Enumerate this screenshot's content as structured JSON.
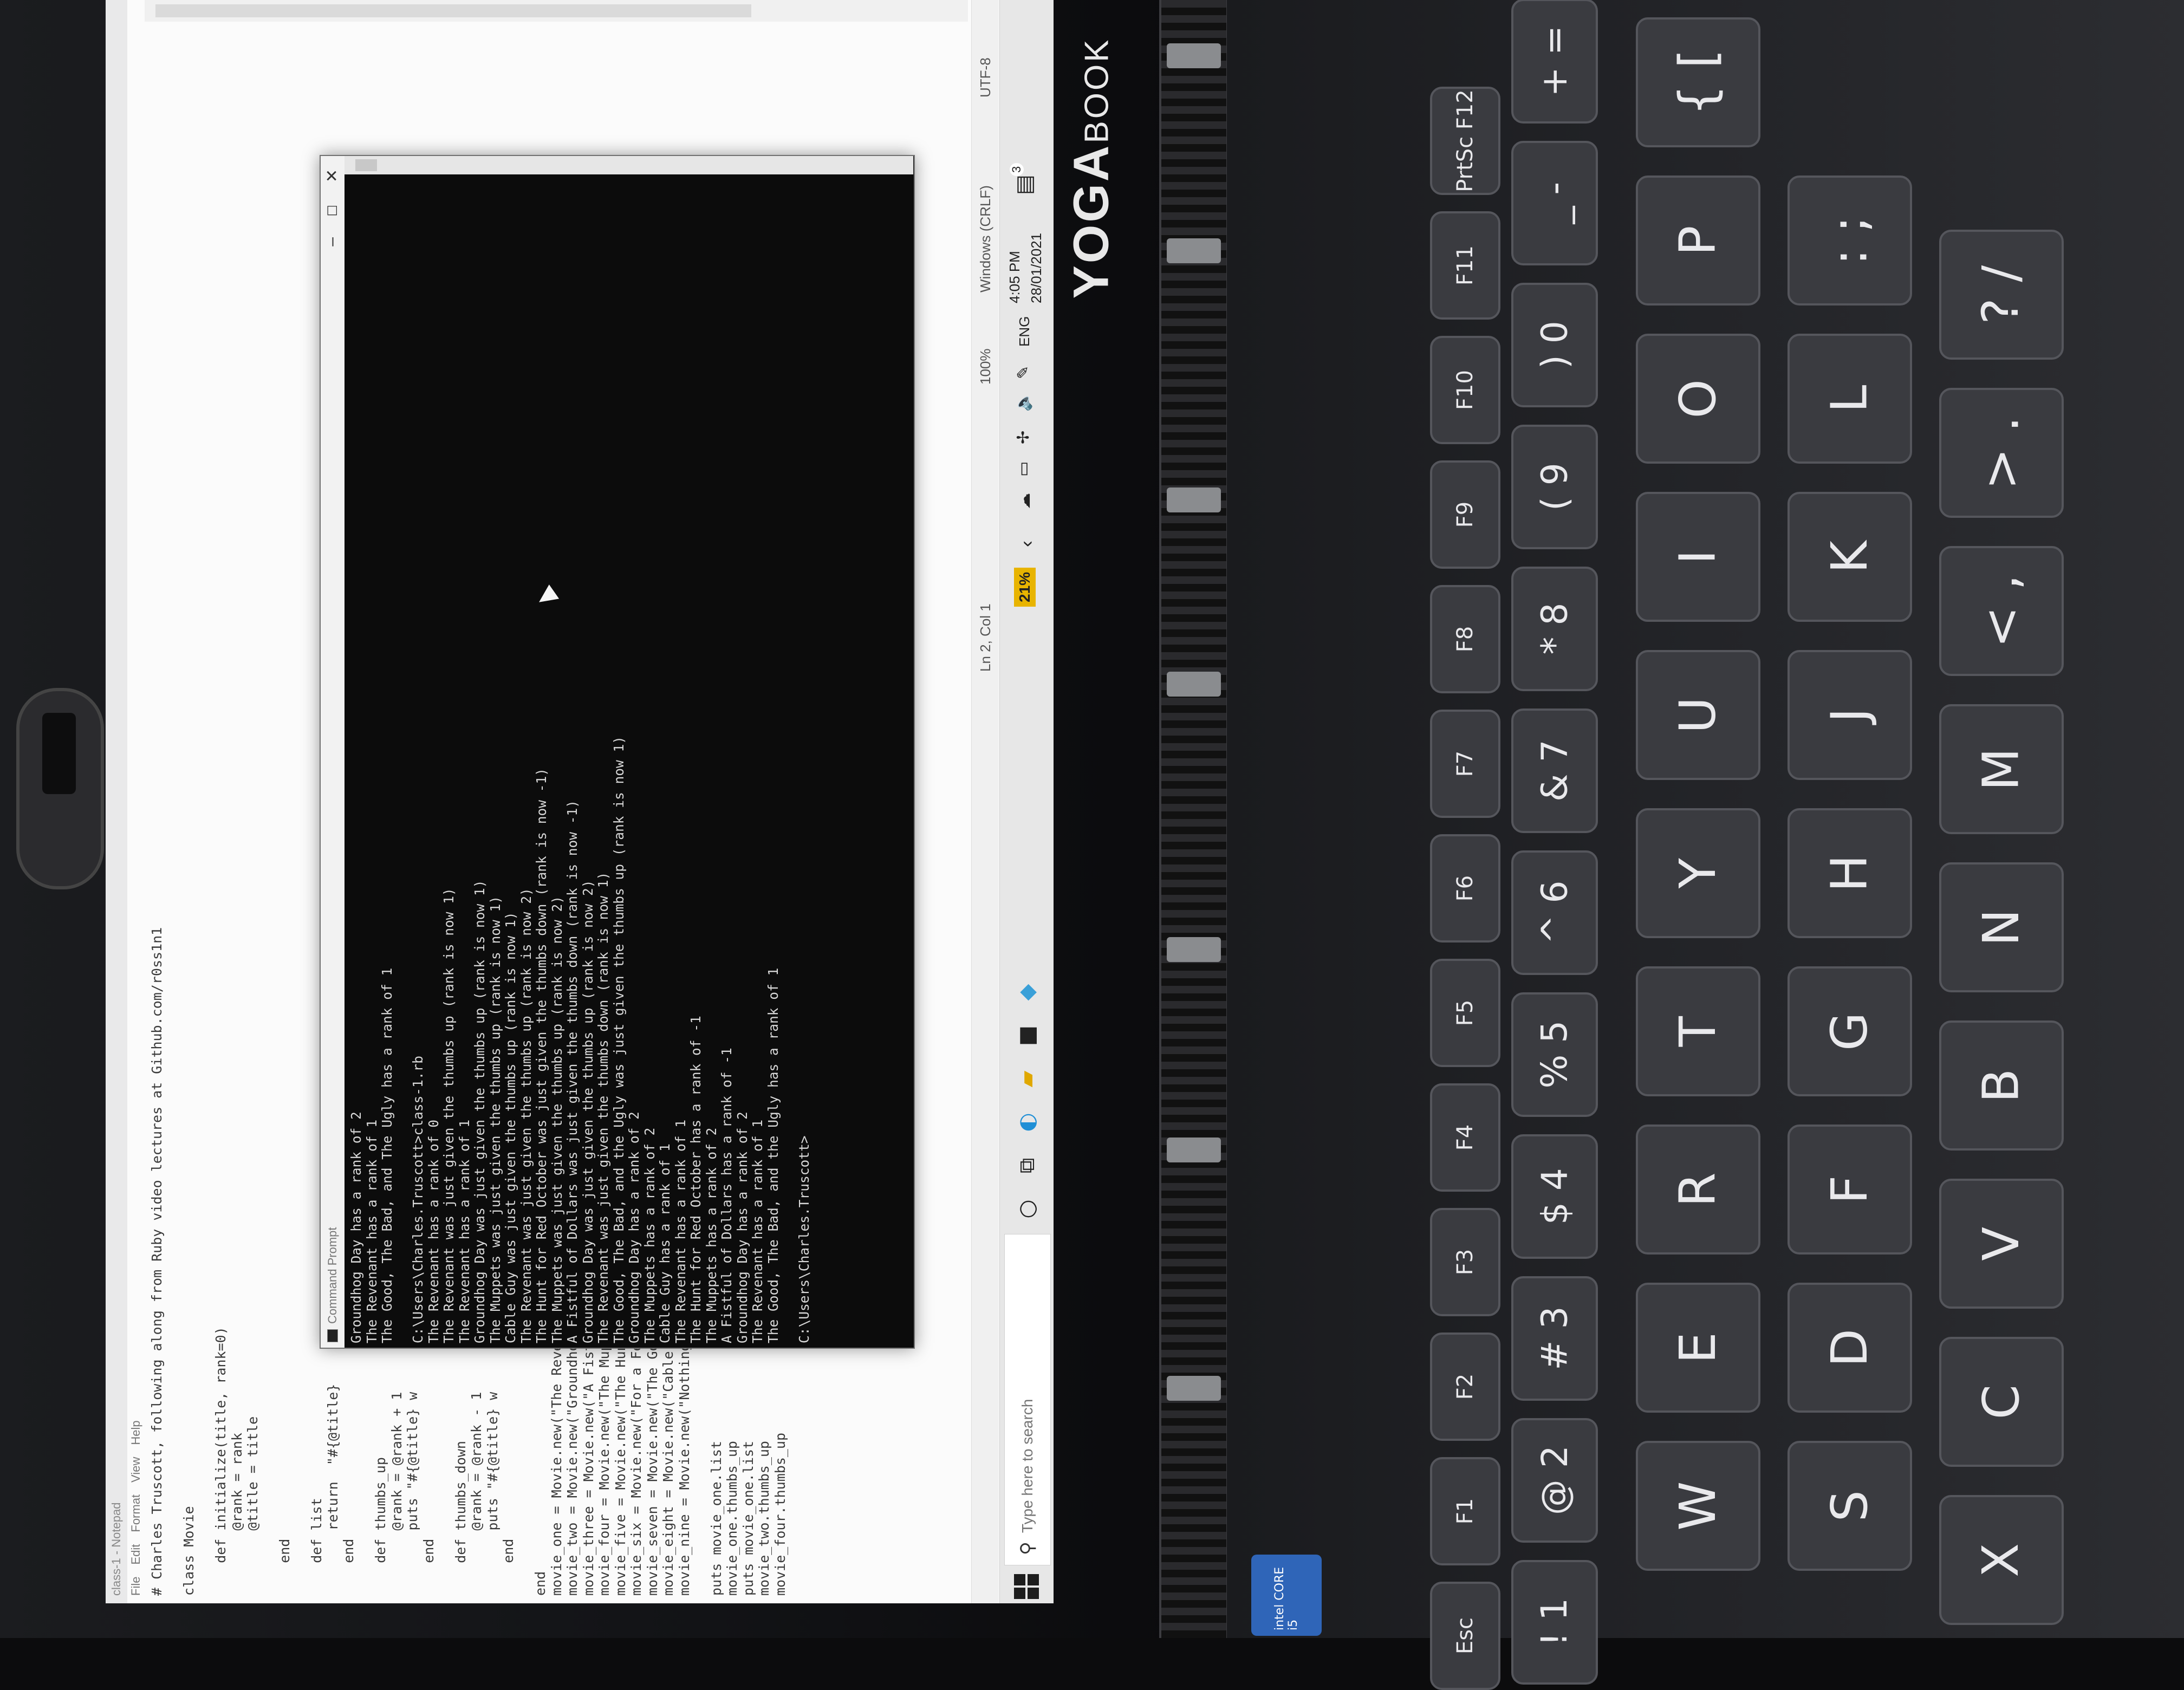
{
  "notepad": {
    "title": "class-1 - Notepad",
    "menu": [
      "File",
      "Edit",
      "Format",
      "View",
      "Help"
    ],
    "code_lines": [
      "# Charles Truscott, following along from Ruby video lectures at Github.com/r0ss1n1",
      "",
      "class Movie",
      "",
      "    def initialize(title, rank=0)",
      "        @rank = rank",
      "        @title = title",
      "",
      "    end",
      "",
      "    def list",
      "        return  \"#{@title}",
      "    end",
      "",
      "    def thumbs_up",
      "        @rank = @rank + 1",
      "        puts \"#{@title} w",
      "    end",
      "",
      "    def thumbs_down",
      "        @rank = @rank - 1",
      "        puts \"#{@title} w",
      "    end",
      "",
      "end",
      "movie_one = Movie.new(\"The Revena",
      "movie_two = Movie.new(\"Groundhog",
      "movie_three = Movie.new(\"A Fistfu",
      "movie_four = Movie.new(\"The Muppe",
      "movie_five = Movie.new(\"The Hunt",
      "movie_six = Movie.new(\"For a Few",
      "movie_seven = Movie.new(\"The Good",
      "movie_eight = Movie.new(\"Cable Gu",
      "movie_nine = Movie.new(\"Nothing t",
      "",
      "puts movie_one.list",
      "movie_one.thumbs_up",
      "puts movie_one.list",
      "movie_two.thumbs_up",
      "movie_four.thumbs_up"
    ],
    "status": {
      "position": "Ln 2, Col 1",
      "zoom": "100%",
      "line_ending": "Windows (CRLF)",
      "encoding": "UTF-8"
    }
  },
  "cmd": {
    "title": "Command Prompt",
    "output_lines": [
      "Groundhog Day has a rank of 2",
      "The Revenant has a rank of 1",
      "The Good, The Bad, and The Ugly has a rank of 1",
      "",
      "C:\\Users\\Charles.Truscott>class-1.rb",
      "The Revenant has a rank of 0",
      "The Revenant was just given the thumbs up (rank is now 1)",
      "The Revenant has a rank of 1",
      "Groundhog Day was just given the thumbs up (rank is now 1)",
      "The Muppets was just given the thumbs up (rank is now 1)",
      "Cable Guy was just given the thumbs up (rank is now 1)",
      "The Revenant was just given the thumbs up (rank is now 2)",
      "The Hunt for Red October was just given the thumbs down (rank is now -1)",
      "The Muppets was just given the thumbs up (rank is now 2)",
      "A Fistful of Dollars was just given the thumbs down (rank is now -1)",
      "Groundhog Day was just given the thumbs up (rank is now 2)",
      "The Revenant was just given the thumbs down (rank is now 1)",
      "The Good, The Bad, and the Ugly was just given the thumbs up (rank is now 1)",
      "Groundhog Day has a rank of 2",
      "The Muppets has a rank of 2",
      "Cable Guy has a rank of 1",
      "The Revenant has a rank of 1",
      "The Hunt for Red October has a rank of -1",
      "The Muppets has a rank of 2",
      "A Fistful of Dollars has a rank of -1",
      "Groundhog Day has a rank of 2",
      "The Revenant has a rank of 1",
      "The Good, The Bad, and the Ugly has a rank of 1",
      "",
      "C:\\Users\\Charles.Truscott>"
    ]
  },
  "taskbar": {
    "search_placeholder": "Type here to search",
    "battery": "21%",
    "language": "ENG",
    "time": "4:05 PM",
    "date": "28/01/2021",
    "notification_count": "3"
  },
  "device": {
    "brand": "YOGA",
    "brand_suffix": "BOOK",
    "badge": "intel CORE i5"
  },
  "keyboard": {
    "fn_row": [
      "Esc",
      "F1",
      "F2",
      "F3",
      "F4",
      "F5",
      "F6",
      "F7",
      "F8",
      "F9",
      "F10",
      "F11",
      "PrtSc F12"
    ],
    "number_row": [
      "! 1",
      "@ 2",
      "# 3",
      "$ 4",
      "% 5",
      "^ 6",
      "& 7",
      "* 8",
      "( 9",
      ") 0",
      "_ -",
      "+ ="
    ],
    "qwerty_row": [
      "W",
      "E",
      "R",
      "T",
      "Y",
      "U",
      "I",
      "O",
      "P",
      "{ ["
    ],
    "home_row": [
      "S",
      "D",
      "F",
      "G",
      "H",
      "J",
      "K",
      "L",
      ": ;"
    ],
    "bottom_row": [
      "X",
      "C",
      "V",
      "B",
      "N",
      "M",
      "< ,",
      "> .",
      "? /"
    ]
  },
  "colors": {
    "cmd_bg": "#0c0c0c",
    "cmd_text": "#d8d8d8",
    "battery_badge": "#e8b400",
    "key_face": "#3a3b40"
  }
}
